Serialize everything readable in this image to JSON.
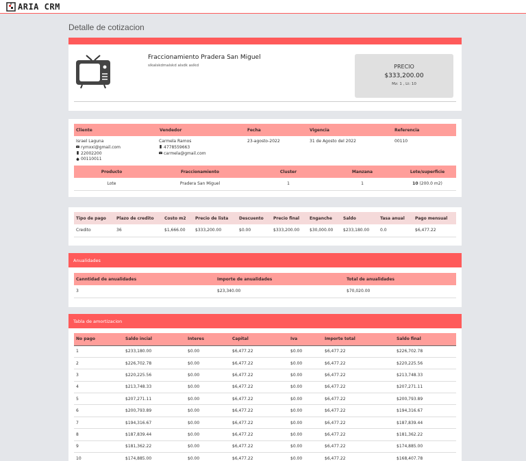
{
  "app": {
    "logo_text": "ARIA CRM"
  },
  "page_title": "Detalle de cotizacion",
  "property": {
    "name": "Fraccionamiento Pradera San Miguel",
    "description": "slkalskdmalskd alsdk aslkd",
    "price_label": "PRECIO",
    "price": "$333,200.00",
    "lot_info": "Mz: 1 , Lt: 10"
  },
  "client_info": {
    "headers": [
      "Cliente",
      "Vendedor",
      "Fecha",
      "Vigencia",
      "Referencia"
    ],
    "client_name": "Israel Laguna",
    "client_email": "rymxxi@gmail.com",
    "client_phone": "22002200",
    "client_alt": "00110011",
    "seller_name": "Carmela Ramos",
    "seller_phone": "4778559663",
    "seller_email": "carmela@gmail.com",
    "date": "23-agosto-2022",
    "validity": "31 de Agosto del 2022",
    "reference": "00110"
  },
  "product": {
    "headers": [
      "Producto",
      "Fraccionamiento",
      "Cluster",
      "Manzana",
      "Lote/superficie"
    ],
    "product": "Lote",
    "development": "Pradera San Miguel",
    "cluster": "1",
    "block": "1",
    "lot_number": "10",
    "lot_area": "(200.0 m2)"
  },
  "payment": {
    "headers": [
      "Tipo de pago",
      "Plazo de credito",
      "Costo m2",
      "Precio de lista",
      "Descuento",
      "Precio final",
      "Enganche",
      "Saldo",
      "Tasa anual",
      "Pago mensual"
    ],
    "row": [
      "Credito",
      "36",
      "$1,666.00",
      "$333,200.00",
      "$0.00",
      "$333,200.00",
      "$30,000.00",
      "$233,180.00",
      "0.0",
      "$6,477.22"
    ]
  },
  "annuities": {
    "title": "Anualidades",
    "headers": [
      "Canntidad de anualidades",
      "Importe de anualidades",
      "Total de anualidades"
    ],
    "row": [
      "3",
      "$23,340.00",
      "$70,020.00"
    ]
  },
  "amortization": {
    "title": "Tabla de amortizacion",
    "headers": [
      "No pago",
      "Saldo incial",
      "Interes",
      "Capital",
      "Iva",
      "Importe total",
      "Saldo final"
    ],
    "rows": [
      [
        "1",
        "$233,180.00",
        "$0.00",
        "$6,477.22",
        "$0.00",
        "$6,477.22",
        "$226,702.78"
      ],
      [
        "2",
        "$226,702.78",
        "$0.00",
        "$6,477.22",
        "$0.00",
        "$6,477.22",
        "$220,225.56"
      ],
      [
        "3",
        "$220,225.56",
        "$0.00",
        "$6,477.22",
        "$0.00",
        "$6,477.22",
        "$213,748.33"
      ],
      [
        "4",
        "$213,748.33",
        "$0.00",
        "$6,477.22",
        "$0.00",
        "$6,477.22",
        "$207,271.11"
      ],
      [
        "5",
        "$207,271.11",
        "$0.00",
        "$6,477.22",
        "$0.00",
        "$6,477.22",
        "$200,793.89"
      ],
      [
        "6",
        "$200,793.89",
        "$0.00",
        "$6,477.22",
        "$0.00",
        "$6,477.22",
        "$194,316.67"
      ],
      [
        "7",
        "$194,316.67",
        "$0.00",
        "$6,477.22",
        "$0.00",
        "$6,477.22",
        "$187,839.44"
      ],
      [
        "8",
        "$187,839.44",
        "$0.00",
        "$6,477.22",
        "$0.00",
        "$6,477.22",
        "$181,362.22"
      ],
      [
        "9",
        "$181,362.22",
        "$0.00",
        "$6,477.22",
        "$0.00",
        "$6,477.22",
        "$174,885.00"
      ],
      [
        "10",
        "$174,885.00",
        "$0.00",
        "$6,477.22",
        "$0.00",
        "$6,477.22",
        "$168,407.78"
      ]
    ]
  },
  "colors": {
    "accent": "#ff5a5a",
    "header_row": "#ff9e9a",
    "background": "#e4e6ea"
  },
  "icons": {
    "tv": "tv-icon",
    "email": "envelope-icon",
    "phone": "phone-icon",
    "apple": "apple-icon"
  }
}
